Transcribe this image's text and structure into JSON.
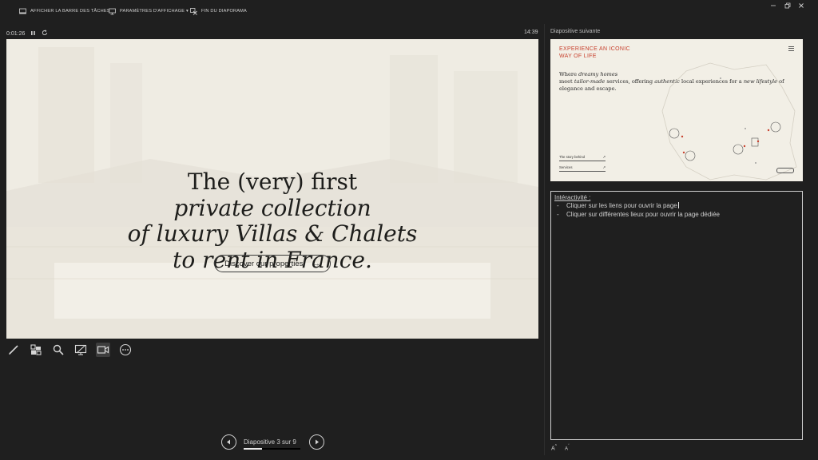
{
  "topbar": {
    "taskbar": "AFFICHER LA BARRE DES TÂCHES",
    "display_settings": "PARAMÈTRES D'AFFICHAGE ▾",
    "end_show": "FIN DU DIAPORAMA"
  },
  "timer": {
    "elapsed": "0:01:26",
    "clock": "14:39"
  },
  "slide": {
    "line1": "The (very) first",
    "line2": "private collection",
    "line3": "of luxury Villas & Chalets",
    "line4": "to rent in France.",
    "cta_label": "Discover our properties",
    "cta_arrow": "→"
  },
  "next_slide": {
    "label": "Diapositive suivante",
    "title_line1": "EXPERIENCE AN ICONIC",
    "title_line2": "WAY OF LIFE",
    "text_parts": [
      "Where ",
      "dreamy homes",
      " meet ",
      "tailor-made",
      " services, offering ",
      "authentic",
      " local experiences for a ",
      "new lifestyle",
      " of elegance and escape."
    ],
    "link1": "The story behind",
    "link2": "Services",
    "link_arrow": "↗"
  },
  "notes": {
    "title": "Intéractivité :",
    "items": [
      "Cliquer sur les liens pour ouvrir la page",
      "Cliquer sur différentes lieux pour ouvrir la page dédiée"
    ],
    "dash": "-"
  },
  "font_buttons": {
    "increase": "A",
    "decrease": "A"
  },
  "navigation": {
    "label": "Diapositive 3 sur 9",
    "progress": 0.33
  }
}
